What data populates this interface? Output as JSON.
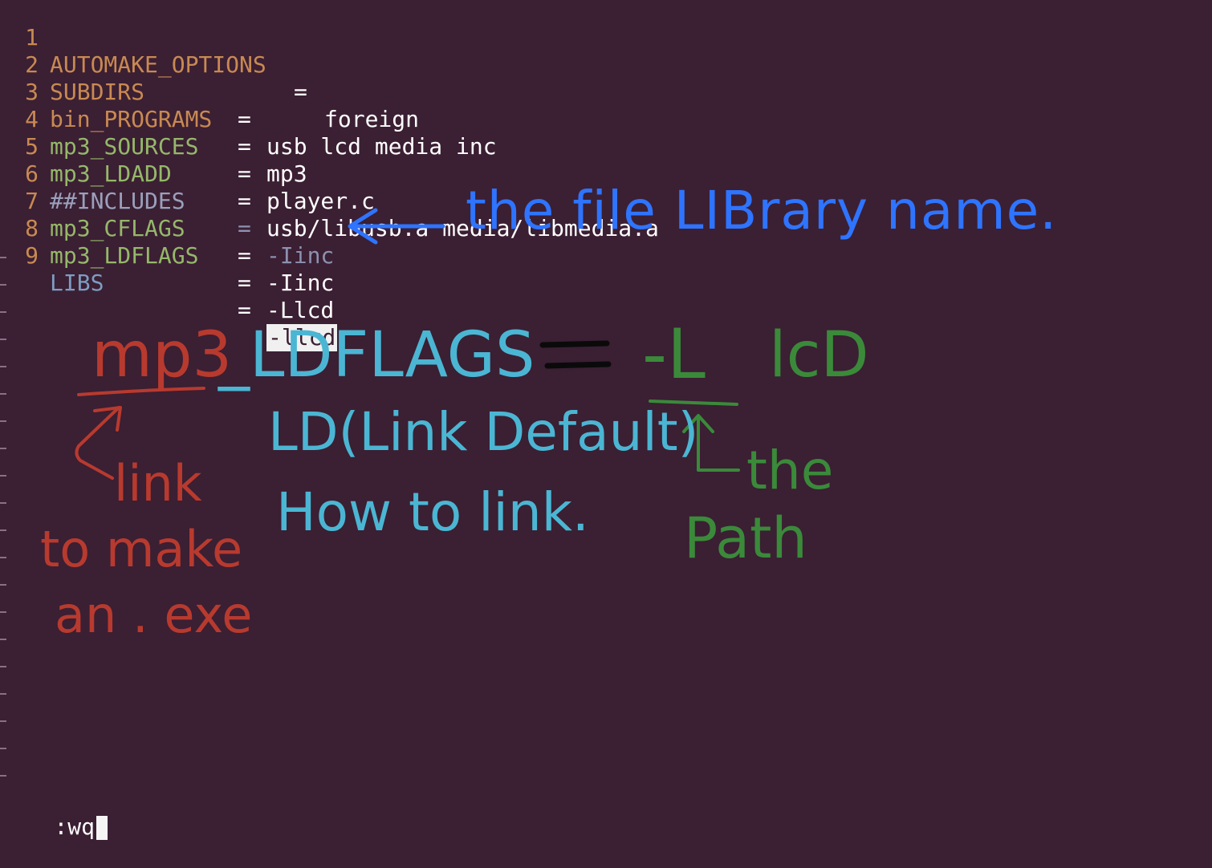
{
  "editor": {
    "lines": [
      {
        "num": "1",
        "key": "AUTOMAKE_OPTIONS",
        "eq": "=",
        "value": "foreign"
      },
      {
        "num": "2",
        "key": "SUBDIRS",
        "eq": "=",
        "value": "usb lcd media inc"
      },
      {
        "num": "3",
        "key": "bin_PROGRAMS",
        "eq": "=",
        "value": "mp3"
      },
      {
        "num": "4",
        "key": "mp3_SOURCES",
        "eq": "=",
        "value": "player.c"
      },
      {
        "num": "5",
        "key": "mp3_LDADD",
        "eq": "=",
        "value": "usb/libusb.a media/libmedia.a"
      },
      {
        "num": "6",
        "key": "##INCLUDES",
        "eq": "=",
        "value": "-Iinc"
      },
      {
        "num": "7",
        "key": "mp3_CFLAGS",
        "eq": "=",
        "value": "-Iinc"
      },
      {
        "num": "8",
        "key": "mp3_LDFLAGS",
        "eq": "=",
        "value": "-Llcd"
      },
      {
        "num": "9",
        "key": "LIBS",
        "eq": "=",
        "value": "-llcd"
      }
    ],
    "command_line": ":wq"
  },
  "annotations": {
    "blue_note": "the file LIBrary name.",
    "formula_left": "mp3",
    "formula_mid": "_LDFLAGS",
    "formula_eq": "=",
    "formula_right": "-L",
    "formula_lcd": "lcD",
    "red_note_1": "link",
    "red_note_2": "to make",
    "red_note_3": "an . exe",
    "cyan_note_1": "LD(Link Default)",
    "cyan_note_2": "How to link.",
    "green_note_1": "the",
    "green_note_2": "Path"
  },
  "colors": {
    "background": "#3b1f33",
    "blue_ink": "#2e74ff",
    "red_ink": "#b83a2e",
    "cyan_ink": "#4bb6d3",
    "green_ink": "#3a8a3a"
  }
}
